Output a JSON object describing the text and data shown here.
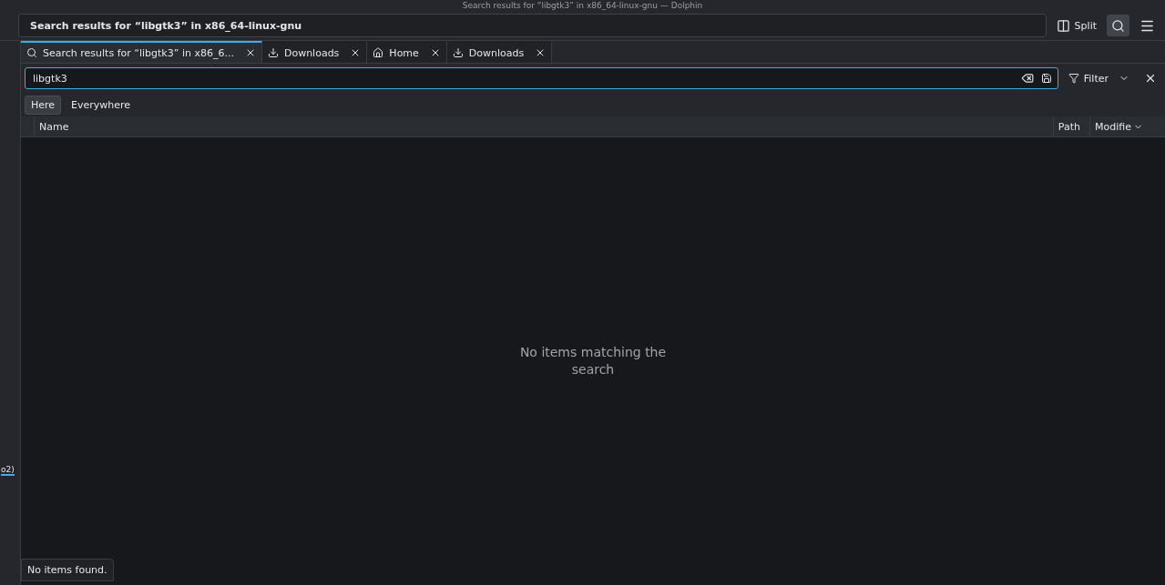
{
  "window": {
    "title": "Search results for “libgtk3” in x86_64-linux-gnu — Dolphin"
  },
  "location_bar": {
    "value": "Search results for “libgtk3” in x86_64-linux-gnu"
  },
  "toolbar": {
    "split_label": "Split",
    "search_active": true
  },
  "side_panel": {
    "partial_text": "o2)"
  },
  "tabs": [
    {
      "label": "Search results for “libgtk3” in x86_6...",
      "kind": "search",
      "selected": true
    },
    {
      "label": "Downloads",
      "kind": "download",
      "selected": false
    },
    {
      "label": "Home",
      "kind": "home",
      "selected": false
    },
    {
      "label": "Downloads",
      "kind": "download",
      "selected": false
    }
  ],
  "search": {
    "value": "libgtk3",
    "filter_label": "Filter"
  },
  "scope": [
    {
      "label": "Here",
      "selected": true
    },
    {
      "label": "Everywhere",
      "selected": false
    }
  ],
  "table": {
    "columns": [
      {
        "label": "Name",
        "sorted": false
      },
      {
        "label": "Path",
        "sorted": false
      },
      {
        "label": "Modifie",
        "sorted": true
      }
    ]
  },
  "empty_message": "No items matching the search",
  "status_bar": "No items found."
}
